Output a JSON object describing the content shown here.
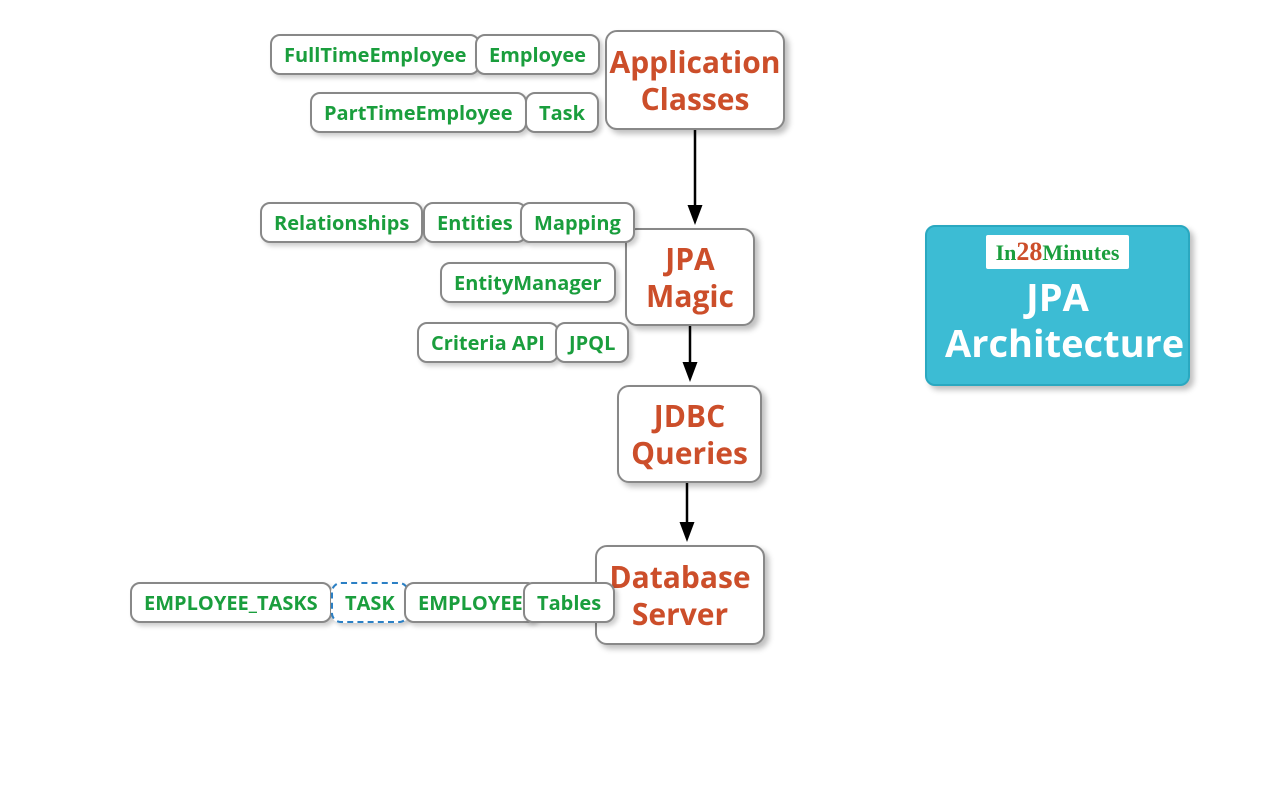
{
  "mainNodes": {
    "applicationClasses": "Application Classes",
    "jpaMagic": "JPA Magic",
    "jdbcQueries": "JDBC Queries",
    "databaseServer": "Database Server"
  },
  "appClassesChildren": {
    "fullTimeEmployee": "FullTimeEmployee",
    "employee": "Employee",
    "partTimeEmployee": "PartTimeEmployee",
    "task": "Task"
  },
  "jpaMagicChildren": {
    "relationships": "Relationships",
    "entities": "Entities",
    "mapping": "Mapping",
    "entityManager": "EntityManager",
    "criteriaApi": "Criteria API",
    "jpql": "JPQL"
  },
  "databaseChildren": {
    "employeeTasks": "EMPLOYEE_TASKS",
    "taskTable": "TASK",
    "employeeTable": "EMPLOYEE",
    "tables": "Tables"
  },
  "titleBox": {
    "brandPrefix": "In",
    "brandNumber": "28",
    "brandSuffix": "Minutes",
    "title": "JPA Architecture"
  },
  "colors": {
    "mainNodeText": "#cc4e2a",
    "subNodeText": "#1a9e3d",
    "titleBg": "#3cbcd4",
    "titleText": "#ffffff",
    "selectedBorder": "#2a7fc4"
  }
}
